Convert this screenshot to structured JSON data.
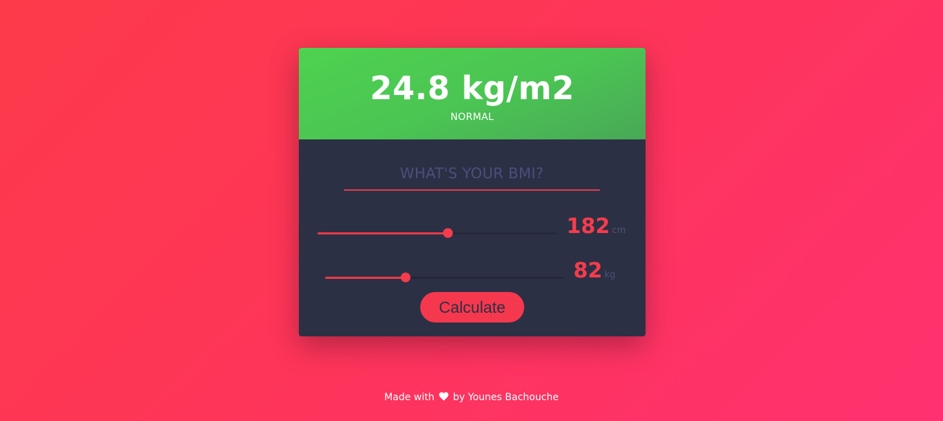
{
  "result": {
    "value": "24.8 kg/m2",
    "category": "NORMAL",
    "color": "#4bc453"
  },
  "form": {
    "question": "WHAT'S YOUR BMI?",
    "height": {
      "value": "182",
      "unit": "cm",
      "fill_fraction": 0.545
    },
    "weight": {
      "value": "82",
      "unit": "kg",
      "fill_fraction": 0.335
    },
    "calculate_label": "Calculate"
  },
  "footer": {
    "prefix": "Made with",
    "icon": "heart-icon",
    "suffix": "by Younes Bachouche"
  },
  "colors": {
    "accent": "#f53c4c",
    "card": "#2c3044",
    "result_green": "#4bc453"
  }
}
